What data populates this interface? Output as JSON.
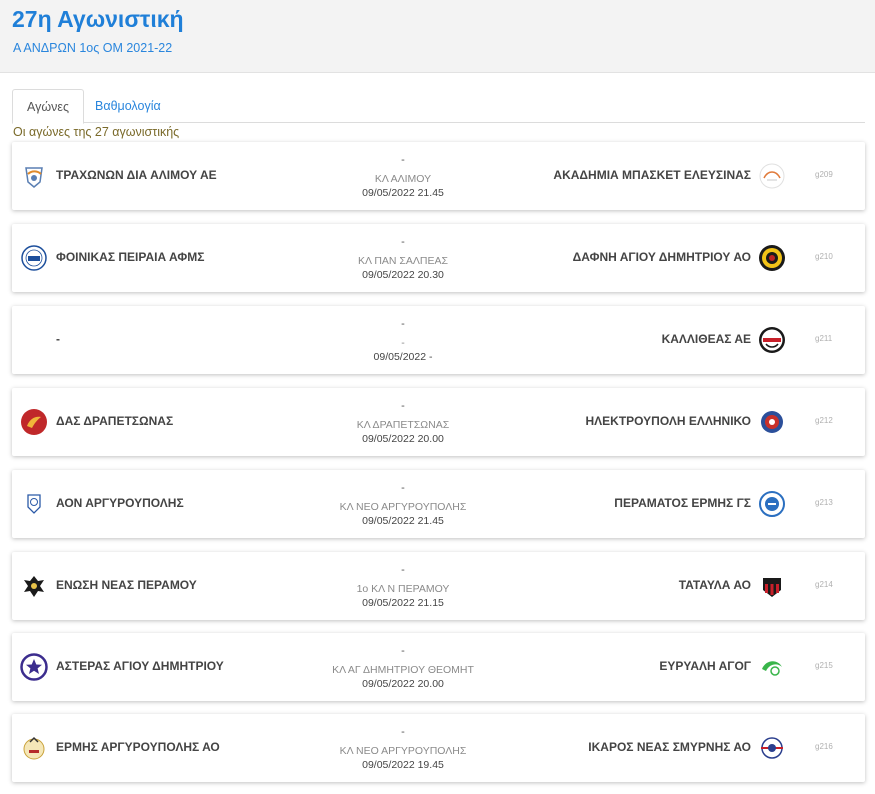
{
  "header": {
    "title": "27η Αγωνιστική",
    "subtitle": "Α ΑΝΔΡΩΝ 1ος ΟΜ 2021-22"
  },
  "tabs": [
    {
      "label": "Αγώνες",
      "active": true
    },
    {
      "label": "Βαθμολογία",
      "active": false
    }
  ],
  "caption": "Οι αγώνες της 27 αγωνιστικής",
  "matches": [
    {
      "home": "ΤΡΑΧΩΝΩΝ ΔΙΑ ΑΛΙΜΟΥ ΑΕ",
      "home_logo": "trachones-logo-icon",
      "score": "-",
      "venue": "ΚΛ ΑΛΙΜΟΥ",
      "datetime": "09/05/2022 21.45",
      "away": "ΑΚΑΔΗΜΙΑ ΜΠΑΣΚΕΤ ΕΛΕΥΣΙΝΑΣ",
      "away_logo": "akadimia-elefsinas-logo-icon",
      "code": "g209"
    },
    {
      "home": "ΦΟΙΝΙΚΑΣ ΠΕΙΡΑΙΑ ΑΦΜΣ",
      "home_logo": "foinikas-logo-icon",
      "score": "-",
      "venue": "ΚΛ ΠΑΝ ΣΑΛΠΕΑΣ",
      "datetime": "09/05/2022 20.30",
      "away": "ΔΑΦΝΗ ΑΓΙΟΥ ΔΗΜΗΤΡΙΟΥ ΑΟ",
      "away_logo": "dafni-logo-icon",
      "code": "g210"
    },
    {
      "home": "-",
      "home_logo": "",
      "score": "-",
      "venue": "-",
      "datetime": "09/05/2022 -",
      "away": "ΚΑΛΛΙΘΕΑΣ ΑΕ",
      "away_logo": "kallitheas-logo-icon",
      "code": "g211"
    },
    {
      "home": "ΔΑΣ ΔΡΑΠΕΤΣΩΝΑΣ",
      "home_logo": "das-drapetsonas-logo-icon",
      "score": "-",
      "venue": "ΚΛ ΔΡΑΠΕΤΣΩΝΑΣ",
      "datetime": "09/05/2022 20.00",
      "away": "ΗΛΕΚΤΡΟΥΠΟΛΗ ΕΛΛΗΝΙΚΟ",
      "away_logo": "ilektroupoli-logo-icon",
      "code": "g212"
    },
    {
      "home": "ΑΟΝ ΑΡΓΥΡΟΥΠΟΛΗΣ",
      "home_logo": "aon-argyroupolis-logo-icon",
      "score": "-",
      "venue": "ΚΛ ΝΕΟ ΑΡΓΥΡΟΥΠΟΛΗΣ",
      "datetime": "09/05/2022 21.45",
      "away": "ΠΕΡΑΜΑΤΟΣ ΕΡΜΗΣ ΓΣ",
      "away_logo": "peramatos-ermis-logo-icon",
      "code": "g213"
    },
    {
      "home": "ΕΝΩΣΗ ΝΕΑΣ ΠΕΡΑΜΟΥ",
      "home_logo": "enosi-peramou-logo-icon",
      "score": "-",
      "venue": "1ο ΚΛ Ν ΠΕΡΑΜΟΥ",
      "datetime": "09/05/2022 21.15",
      "away": "ΤΑΤΑΥΛΑ ΑΟ",
      "away_logo": "tatavla-logo-icon",
      "code": "g214"
    },
    {
      "home": "ΑΣΤΕΡΑΣ ΑΓΙΟΥ ΔΗΜΗΤΡΙΟΥ",
      "home_logo": "asteras-logo-icon",
      "score": "-",
      "venue": "ΚΛ ΑΓ ΔΗΜΗΤΡΙΟΥ ΘΕΟΜΗΤ",
      "datetime": "09/05/2022 20.00",
      "away": "ΕΥΡΥΑΛΗ ΑΓΟΓ",
      "away_logo": "evryali-logo-icon",
      "code": "g215"
    },
    {
      "home": "ΕΡΜΗΣ ΑΡΓΥΡΟΥΠΟΛΗΣ ΑΟ",
      "home_logo": "ermis-argyroupolis-logo-icon",
      "score": "-",
      "venue": "ΚΛ ΝΕΟ ΑΡΓΥΡΟΥΠΟΛΗΣ",
      "datetime": "09/05/2022 19.45",
      "away": "ΙΚΑΡΟΣ ΝΕΑΣ ΣΜΥΡΝΗΣ ΑΟ",
      "away_logo": "ikaros-logo-icon",
      "code": "g216"
    }
  ],
  "colors": {
    "accent": "#1f7fd8",
    "link": "#2a86dd",
    "caption": "#7a6a2a",
    "header_bg": "#f3f3f3"
  }
}
